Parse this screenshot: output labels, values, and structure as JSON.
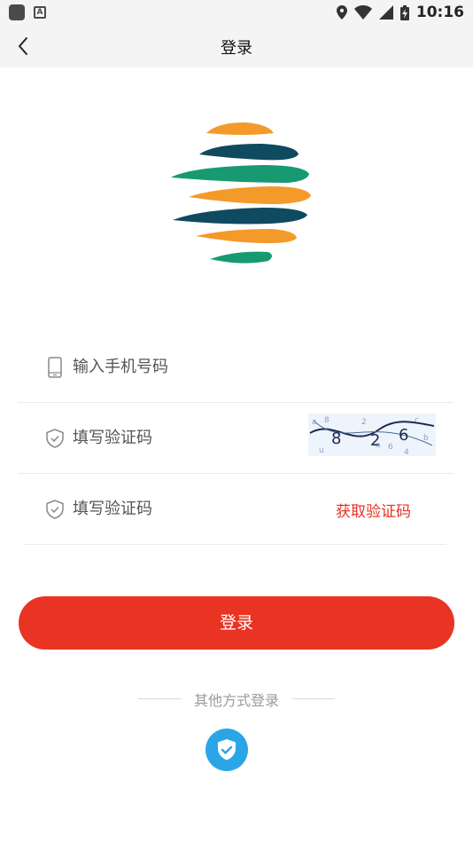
{
  "status_bar": {
    "time": "10:16",
    "icons": [
      "app-square-icon",
      "a-badge-icon",
      "location-icon",
      "wifi-icon",
      "signal-icon",
      "battery-icon"
    ]
  },
  "nav": {
    "title": "登录",
    "back_icon": "chevron-left-icon"
  },
  "logo": {
    "icon": "striped-globe-logo",
    "colors": [
      "#f39a2a",
      "#0f4a60",
      "#179a72"
    ]
  },
  "form": {
    "phone": {
      "placeholder": "输入手机号码",
      "icon": "phone-icon"
    },
    "captcha_field": {
      "placeholder": "填写验证码",
      "icon": "shield-check-icon",
      "captcha_text": "8 2 6"
    },
    "sms_code": {
      "placeholder": "填写验证码",
      "icon": "shield-check-icon",
      "get_code_label": "获取验证码"
    }
  },
  "login_button": {
    "label": "登录",
    "color": "#e93424"
  },
  "other_login": {
    "label": "其他方式登录",
    "method_icon": "shield-check-icon",
    "method_color": "#2aa6e8"
  },
  "colors": {
    "accent": "#e93424",
    "link": "#e63225"
  }
}
